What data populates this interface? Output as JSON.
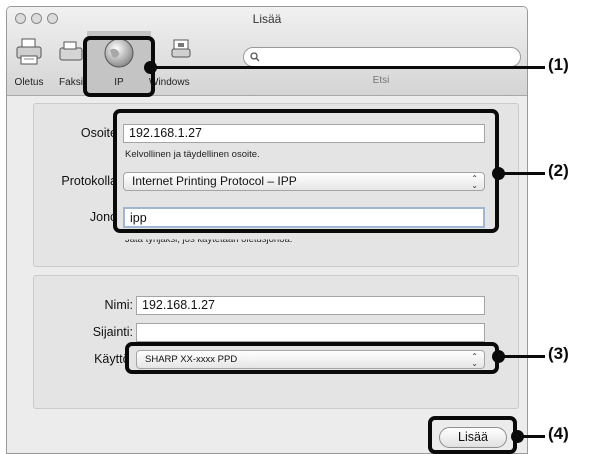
{
  "window": {
    "title": "Lisää"
  },
  "toolbar": {
    "items": [
      {
        "label": "Oletus",
        "icon": "default-printer-icon"
      },
      {
        "label": "Faksi",
        "icon": "fax-icon"
      },
      {
        "label": "IP",
        "icon": "globe-icon"
      },
      {
        "label": "Windows",
        "icon": "windows-printer-icon"
      }
    ],
    "search_label": "Etsi"
  },
  "form": {
    "address_label": "Osoite",
    "address_value": "192.168.1.27",
    "address_hint": "Kelvollinen ja täydellinen osoite.",
    "protocol_label": "Protokolla",
    "protocol_value": "Internet Printing Protocol – IPP",
    "queue_label": "Jono",
    "queue_value": "ipp",
    "queue_hint": "Jätä tyhjäksi, jos käytetään oletusjonoa."
  },
  "printer": {
    "name_label": "Nimi:",
    "name_value": "192.168.1.27",
    "location_label": "Sijainti:",
    "location_value": "",
    "use_label": "Käyttö:",
    "use_value": "SHARP XX-xxxx PPD"
  },
  "add_button": "Lisää",
  "callouts": [
    "(1)",
    "(2)",
    "(3)",
    "(4)"
  ]
}
